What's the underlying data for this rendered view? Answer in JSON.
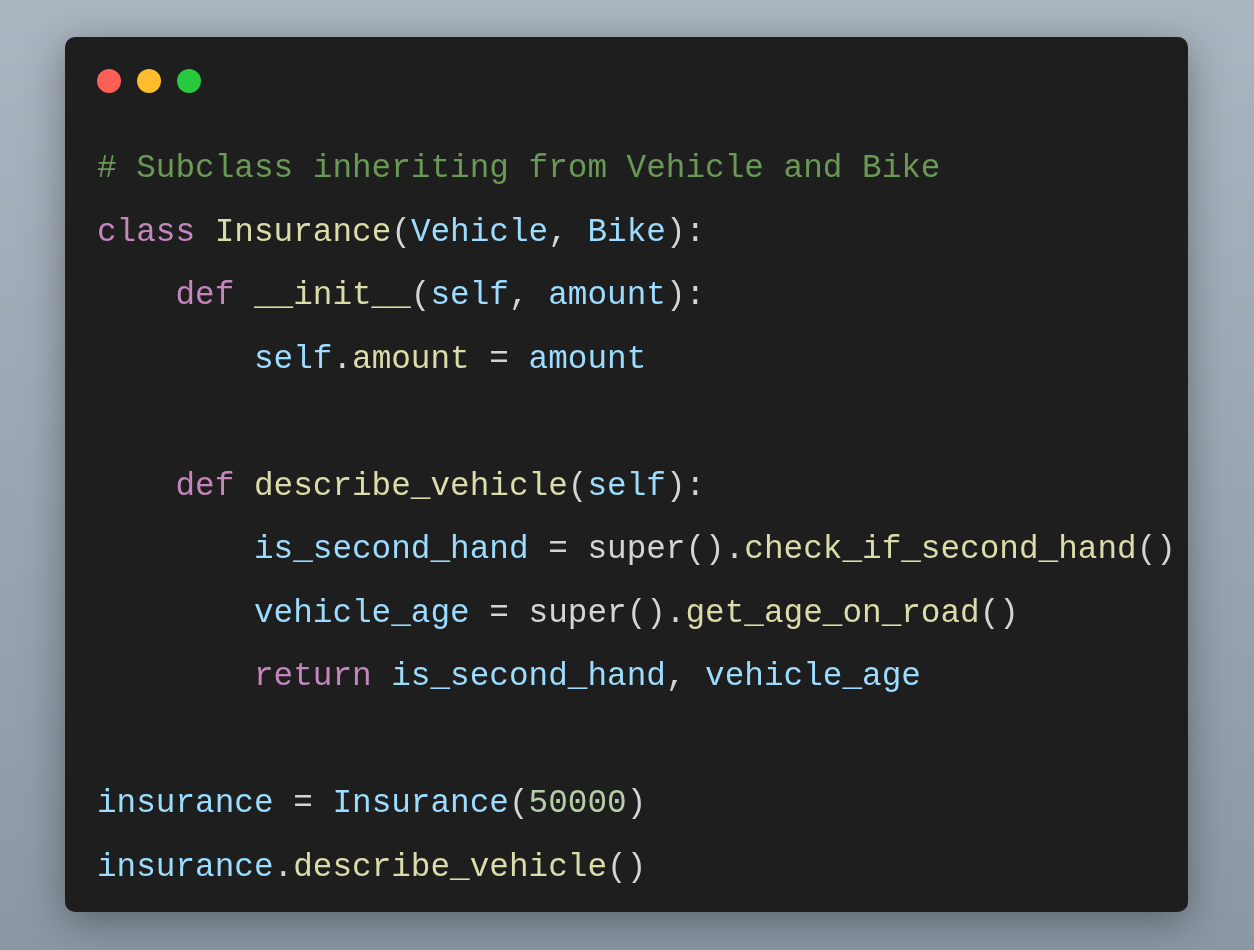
{
  "window": {
    "controls": [
      {
        "color": "#ff5f56"
      },
      {
        "color": "#ffbd2e"
      },
      {
        "color": "#27c93f"
      }
    ]
  },
  "code": {
    "lines": [
      {
        "kind": "code",
        "tokens": [
          {
            "kind": "comment",
            "text": "# Subclass inheriting from Vehicle and Bike"
          }
        ]
      },
      {
        "kind": "code",
        "tokens": [
          {
            "kind": "keyword",
            "text": "class"
          },
          {
            "kind": "func",
            "text": " Insurance"
          },
          {
            "kind": "plain",
            "text": "("
          },
          {
            "kind": "var",
            "text": "Vehicle"
          },
          {
            "kind": "plain",
            "text": ", "
          },
          {
            "kind": "var",
            "text": "Bike"
          },
          {
            "kind": "plain",
            "text": "):"
          }
        ]
      },
      {
        "kind": "code",
        "tokens": [
          {
            "kind": "keyword",
            "text": "    def"
          },
          {
            "kind": "func",
            "text": " __init__"
          },
          {
            "kind": "plain",
            "text": "("
          },
          {
            "kind": "var",
            "text": "self"
          },
          {
            "kind": "plain",
            "text": ", "
          },
          {
            "kind": "var",
            "text": "amount"
          },
          {
            "kind": "plain",
            "text": "):"
          }
        ]
      },
      {
        "kind": "code",
        "tokens": [
          {
            "kind": "var",
            "text": "        self"
          },
          {
            "kind": "plain",
            "text": "."
          },
          {
            "kind": "func",
            "text": "amount"
          },
          {
            "kind": "plain",
            "text": " = "
          },
          {
            "kind": "var",
            "text": "amount"
          }
        ]
      },
      {
        "kind": "blank"
      },
      {
        "kind": "code",
        "tokens": [
          {
            "kind": "keyword",
            "text": "    def"
          },
          {
            "kind": "func",
            "text": " describe_vehicle"
          },
          {
            "kind": "plain",
            "text": "("
          },
          {
            "kind": "var",
            "text": "self"
          },
          {
            "kind": "plain",
            "text": "):"
          }
        ]
      },
      {
        "kind": "code",
        "tokens": [
          {
            "kind": "var",
            "text": "        is_second_hand"
          },
          {
            "kind": "plain",
            "text": " = super()."
          },
          {
            "kind": "func",
            "text": "check_if_second_hand"
          },
          {
            "kind": "plain",
            "text": "()"
          }
        ]
      },
      {
        "kind": "code",
        "tokens": [
          {
            "kind": "var",
            "text": "        vehicle_age"
          },
          {
            "kind": "plain",
            "text": " = super()."
          },
          {
            "kind": "func",
            "text": "get_age_on_road"
          },
          {
            "kind": "plain",
            "text": "()"
          }
        ]
      },
      {
        "kind": "code",
        "tokens": [
          {
            "kind": "keyword",
            "text": "        return"
          },
          {
            "kind": "var",
            "text": " is_second_hand"
          },
          {
            "kind": "plain",
            "text": ", "
          },
          {
            "kind": "var",
            "text": "vehicle_age"
          }
        ]
      },
      {
        "kind": "blank"
      },
      {
        "kind": "code",
        "tokens": [
          {
            "kind": "var",
            "text": "insurance"
          },
          {
            "kind": "plain",
            "text": " = "
          },
          {
            "kind": "var",
            "text": "Insurance"
          },
          {
            "kind": "plain",
            "text": "("
          },
          {
            "kind": "number",
            "text": "50000"
          },
          {
            "kind": "plain",
            "text": ")"
          }
        ]
      },
      {
        "kind": "code",
        "tokens": [
          {
            "kind": "var",
            "text": "insurance"
          },
          {
            "kind": "plain",
            "text": "."
          },
          {
            "kind": "func",
            "text": "describe_vehicle"
          },
          {
            "kind": "plain",
            "text": "()"
          }
        ]
      }
    ]
  }
}
